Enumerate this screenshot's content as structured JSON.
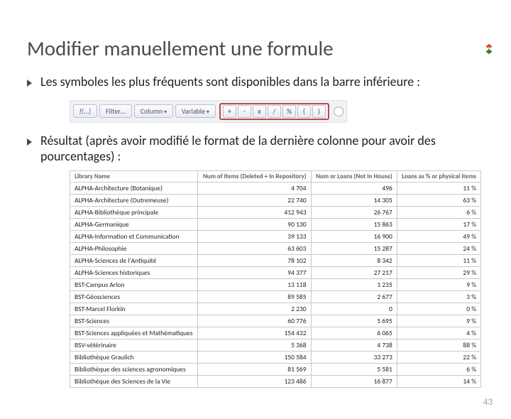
{
  "logo": "logo-icon",
  "title": "Modifier manuellement une formule",
  "bullets": [
    "Les symboles les plus fréquents sont disponibles dans la barre inférieure :",
    "Résultat (après avoir modifié le format de la dernière colonne pour avoir des pourcentages) :"
  ],
  "toolbar": {
    "fx": "f(…)",
    "filter": "Filter…",
    "column": "Column",
    "variable": "Variable",
    "ops": [
      "+",
      "-",
      "x",
      "/",
      "%",
      "(",
      ")"
    ]
  },
  "table": {
    "headers": [
      "Library Name",
      "Num of Items (Deleted + In Repository)",
      "Num or Loans (Not In House)",
      "Loans as % or physical items"
    ],
    "rows": [
      [
        "ALPHA-Architecture (Botanique)",
        "4 704",
        "496",
        "11 %"
      ],
      [
        "ALPHA-Architecture (Outremeuse)",
        "22 740",
        "14 305",
        "63 %"
      ],
      [
        "ALPHA-Bibliothèque principale",
        "412 943",
        "26 767",
        "6 %"
      ],
      [
        "ALPHA-Germanique",
        "90 130",
        "15 863",
        "17 %"
      ],
      [
        "ALPHA-Information et Communication",
        "39 133",
        "16 900",
        "49 %"
      ],
      [
        "ALPHA-Philosophie",
        "63 603",
        "15 287",
        "24 %"
      ],
      [
        "ALPHA-Sciences de l'Antiquité",
        "78 102",
        "8 342",
        "11 %"
      ],
      [
        "ALPHA-Sciences historiques",
        "94 377",
        "27 217",
        "29 %"
      ],
      [
        "BST-Campus Arlon",
        "13 118",
        "1 235",
        "9 %"
      ],
      [
        "BST-Géosciences",
        "89 585",
        "2 677",
        "3 %"
      ],
      [
        "BST-Marcel Florkin",
        "2 230",
        "0",
        "0 %"
      ],
      [
        "BST-Sciences",
        "60 776",
        "5 695",
        "9 %"
      ],
      [
        "BST-Sciences appliquées et Mathématiques",
        "154 432",
        "6 065",
        "4 %"
      ],
      [
        "BSV-vétérinaire",
        "5 368",
        "4 738",
        "88 %"
      ],
      [
        "Bibliothèque Graulich",
        "150 584",
        "33 273",
        "22 %"
      ],
      [
        "Bibliothèque des sciences agronomiques",
        "81 569",
        "5 581",
        "6 %"
      ],
      [
        "Bibliothèque des Sciences de la Vie",
        "123 486",
        "16 877",
        "14 %"
      ]
    ]
  },
  "page_number": "43"
}
